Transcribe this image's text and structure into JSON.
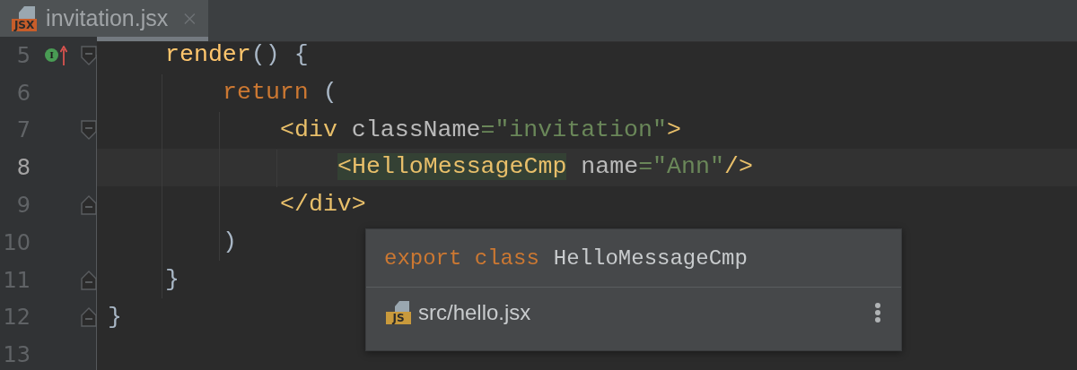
{
  "tabs": [
    {
      "label": "invitation.jsx",
      "file_badge": "JSX",
      "selected": true
    }
  ],
  "lines": [
    {
      "children": [
        {
          "number": "5",
          "current": false,
          "fold_start": true,
          "marker": "I",
          "tokens": [
            {
              "kind": "function",
              "text": "render"
            },
            {
              "kind": "punct",
              "text": "() {"
            }
          ],
          "children": [
            {
              "number": "6",
              "current": false,
              "tokens": [
                {
                  "kind": "keyword",
                  "text": "return"
                },
                {
                  "kind": "punct",
                  "text": " ("
                }
              ],
              "children": [
                {
                  "number": "7",
                  "current": false,
                  "fold_start": true,
                  "tokens": [
                    {
                      "kind": "tag",
                      "text": "<div"
                    },
                    {
                      "kind": "attr",
                      "text": " className"
                    },
                    {
                      "kind": "string",
                      "text": "=\"invitation\""
                    },
                    {
                      "kind": "tag",
                      "text": ">"
                    }
                  ],
                  "children": [
                    {
                      "number": "8",
                      "current": true,
                      "tokens": [
                        {
                          "kind": "tag",
                          "text": "<",
                          "highlighted": true
                        },
                        {
                          "kind": "tag",
                          "text": "HelloMessageCmp",
                          "highlighted": true
                        },
                        {
                          "kind": "attr",
                          "text": " name"
                        },
                        {
                          "kind": "string",
                          "text": "=\"Ann\""
                        },
                        {
                          "kind": "tag",
                          "text": "/>"
                        }
                      ]
                    }
                  ]
                },
                {
                  "number": "9",
                  "current": false,
                  "fold_end": true,
                  "tokens": [
                    {
                      "kind": "tag",
                      "text": "</div>"
                    }
                  ]
                }
              ]
            },
            {
              "number": "10",
              "current": false,
              "tokens": [
                {
                  "kind": "punct",
                  "text": ")"
                }
              ]
            }
          ]
        },
        {
          "number": "11",
          "current": false,
          "fold_end": true,
          "tokens": [
            {
              "kind": "punct",
              "text": "}"
            }
          ]
        }
      ]
    },
    {
      "number": "12",
      "current": false,
      "fold_end": true,
      "tokens": [
        {
          "kind": "punct",
          "text": "}"
        }
      ]
    },
    {
      "number": "13",
      "current": false
    }
  ],
  "popup": {
    "declaration": [
      {
        "kind": "keyword",
        "text": "export class"
      },
      {
        "kind": "name",
        "text": "HelloMessageCmp"
      }
    ],
    "location": {
      "file_badge": "JS",
      "path": "src/hello.jsx"
    }
  }
}
